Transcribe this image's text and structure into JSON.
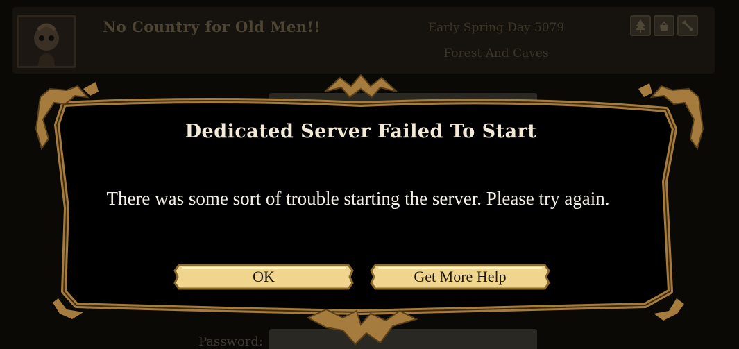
{
  "header": {
    "server_name": "No Country for Old Men!!",
    "season": "Early Spring Day 5079",
    "world": "Forest And Caves",
    "icons": [
      "tree-icon",
      "pot-icon",
      "wrench-icon"
    ]
  },
  "form": {
    "password_label": "Password:"
  },
  "dialog": {
    "title": "Dedicated Server Failed To Start",
    "message": "There was some sort of trouble starting the server. Please try again.",
    "ok_label": "OK",
    "help_label": "Get More Help"
  },
  "colors": {
    "frame_gold": "#a57c3e",
    "button_gold": "#f0d58f",
    "dialog_bg": "#000000",
    "title_text": "#f2ead6"
  }
}
